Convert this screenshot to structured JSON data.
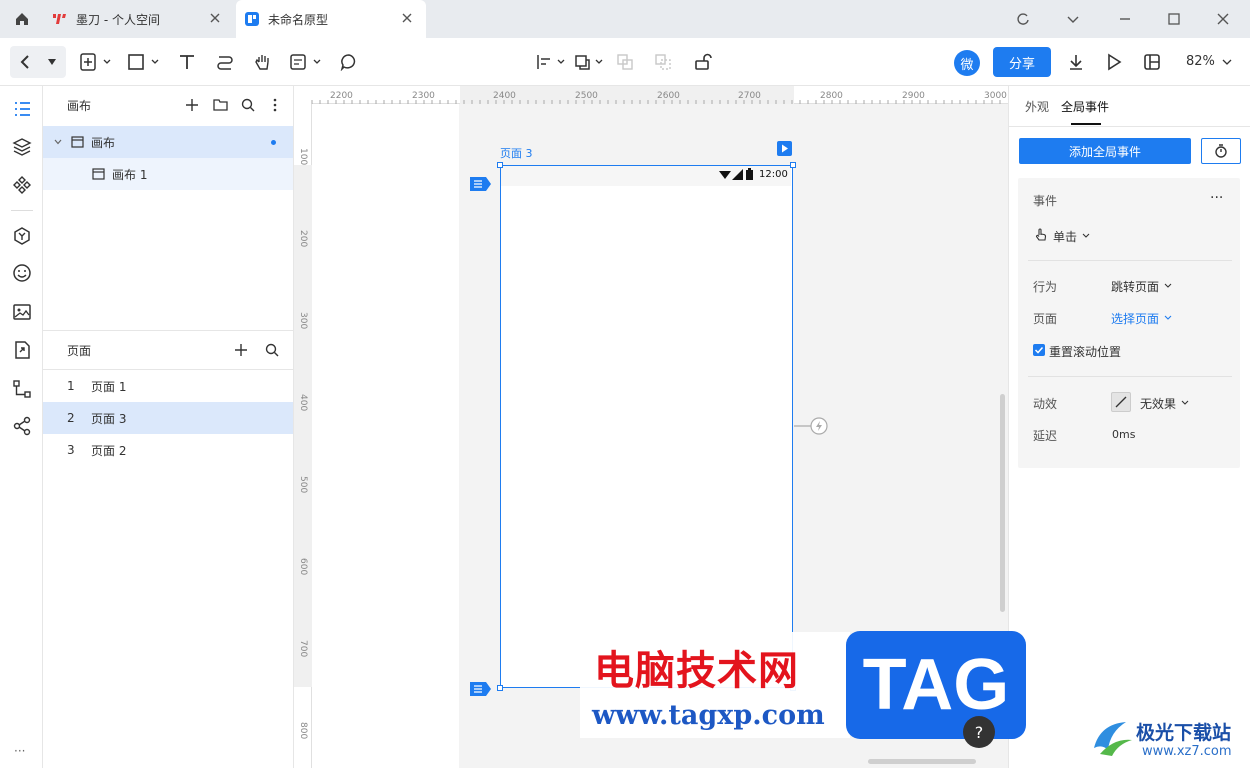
{
  "tabs": [
    {
      "label": "墨刀 - 个人空间"
    },
    {
      "label": "未命名原型"
    }
  ],
  "toolbar": {
    "avatar_label": "微",
    "share_label": "分享",
    "zoom": "82%"
  },
  "layers": {
    "title": "画布",
    "items": [
      {
        "label": "画布"
      },
      {
        "label": "画布 1"
      }
    ]
  },
  "pages": {
    "title": "页面",
    "items": [
      {
        "num": "1",
        "label": "页面 1"
      },
      {
        "num": "2",
        "label": "页面 3"
      },
      {
        "num": "3",
        "label": "页面 2"
      }
    ]
  },
  "ruler": {
    "top": [
      "2200",
      "2300",
      "2400",
      "2500",
      "2600",
      "2700",
      "2800",
      "2900",
      "3000"
    ],
    "left": [
      "100",
      "200",
      "300",
      "400",
      "500",
      "600",
      "700",
      "800"
    ]
  },
  "canvas": {
    "frame_label": "页面 3",
    "status_time": "12:00"
  },
  "right_panel": {
    "tabs": [
      "外观",
      "全局事件"
    ],
    "add_event_label": "添加全局事件",
    "event_title": "事件",
    "trigger": "单击",
    "action_label": "行为",
    "action_value": "跳转页面",
    "page_label": "页面",
    "page_value": "选择页面",
    "reset_scroll": "重置滚动位置",
    "effect_label": "动效",
    "effect_value": "无效果",
    "delay_label": "延迟",
    "delay_value": "0ms"
  },
  "watermark": {
    "site_cn": "电脑技术网",
    "site_url": "www.tagxp.com",
    "tag": "TAG",
    "corner_cn": "极光下载站",
    "corner_url": "www.xz7.com"
  },
  "colors": {
    "accent": "#1e7cf0",
    "selected_row": "#dbe8fb",
    "watermark_red": "#e3141d"
  }
}
